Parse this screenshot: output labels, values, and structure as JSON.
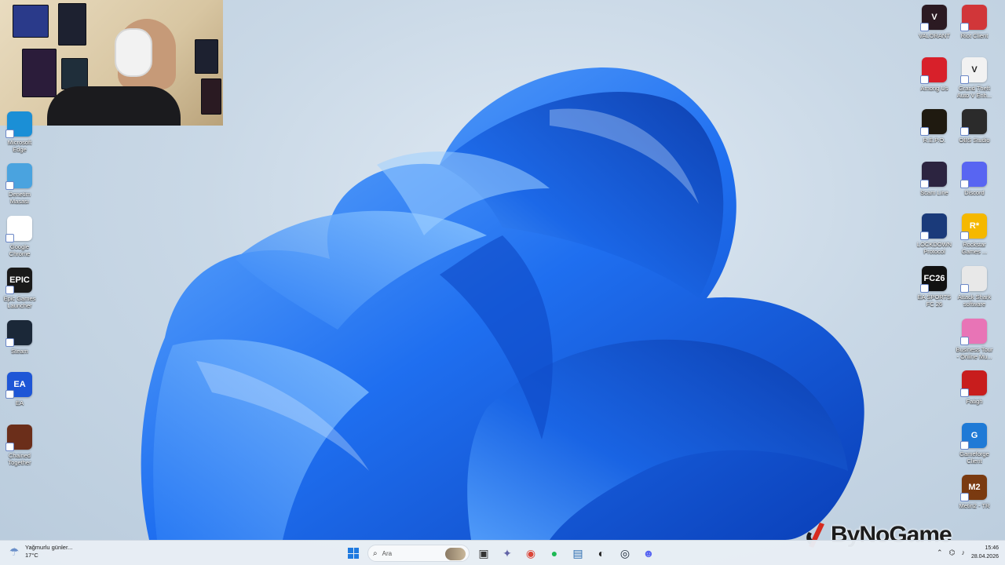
{
  "desktop": {
    "left_icons": [
      {
        "label": "Microsoft\nEdge",
        "color": "#1b8fd6",
        "glyph": "",
        "icon": "edge-icon"
      },
      {
        "label": "Denetim\nMasası",
        "color": "#4aa3df",
        "glyph": "",
        "icon": "control-panel-icon"
      },
      {
        "label": "Google\nChrome",
        "color": "#ffffff",
        "glyph": "",
        "icon": "chrome-icon"
      },
      {
        "label": "Epic Games\nLauncher",
        "color": "#1a1a1a",
        "glyph": "EPIC",
        "icon": "epic-games-icon"
      },
      {
        "label": "Steam",
        "color": "#1b2838",
        "glyph": "",
        "icon": "steam-icon"
      },
      {
        "label": "EA",
        "color": "#1e56d6",
        "glyph": "EA",
        "icon": "ea-icon"
      },
      {
        "label": "Chained\nTogether",
        "color": "#6b2e1a",
        "glyph": "",
        "icon": "chained-together-icon"
      }
    ],
    "right_icons_col1": [
      {
        "label": "VALORANT",
        "color": "#2b1a22",
        "glyph": "V",
        "icon": "valorant-icon"
      },
      {
        "label": "Among Us",
        "color": "#d8202a",
        "glyph": "",
        "icon": "among-us-icon"
      },
      {
        "label": "R.E.P.O.",
        "color": "#1f1a10",
        "glyph": "",
        "icon": "repo-icon"
      },
      {
        "label": "Scam Line",
        "color": "#2c2440",
        "glyph": "",
        "icon": "scam-line-icon"
      },
      {
        "label": "LOCKDOWN\nProtocol",
        "color": "#1a3a7a",
        "glyph": "",
        "icon": "lockdown-protocol-icon"
      },
      {
        "label": "EA SPORTS\nFC 26",
        "color": "#111111",
        "glyph": "FC26",
        "icon": "ea-fc26-icon"
      }
    ],
    "right_icons_col2": [
      {
        "label": "Riot Client",
        "color": "#d13639",
        "glyph": "",
        "icon": "riot-client-icon"
      },
      {
        "label": "Grand Theft\nAuto V Enh...",
        "color": "#f2f2f2",
        "glyph": "V",
        "icon": "gta-v-icon"
      },
      {
        "label": "OBS Studio",
        "color": "#2b2b2b",
        "glyph": "",
        "icon": "obs-studio-icon"
      },
      {
        "label": "Discord",
        "color": "#5865f2",
        "glyph": "",
        "icon": "discord-icon"
      },
      {
        "label": "Rockstar\nGames ...",
        "color": "#f5b800",
        "glyph": "R*",
        "icon": "rockstar-games-icon"
      },
      {
        "label": "Attack Shark\nsoftware",
        "color": "#e8e8e8",
        "glyph": "",
        "icon": "attack-shark-icon"
      },
      {
        "label": "Business Tour\n- Online Mu...",
        "color": "#e874b6",
        "glyph": "",
        "icon": "business-tour-icon"
      },
      {
        "label": "Fatigh",
        "color": "#c81d1d",
        "glyph": "",
        "icon": "fatigh-icon"
      },
      {
        "label": "Gameforge\nClient",
        "color": "#1f7ad6",
        "glyph": "G",
        "icon": "gameforge-icon"
      },
      {
        "label": "Metin2 - TR",
        "color": "#7a3a10",
        "glyph": "M2",
        "icon": "metin2-icon"
      }
    ]
  },
  "watermark": {
    "text": "ByNoGame"
  },
  "taskbar": {
    "weather": {
      "line1": "Yağmurlu günler...",
      "line2": "17°C"
    },
    "search_placeholder": "Ara",
    "apps": [
      {
        "icon": "task-view-icon",
        "glyph": "▣",
        "color": "#333333"
      },
      {
        "icon": "teams-icon",
        "glyph": "✦",
        "color": "#6264a7"
      },
      {
        "icon": "chrome-icon",
        "glyph": "◉",
        "color": "#db4437"
      },
      {
        "icon": "spotify-icon",
        "glyph": "●",
        "color": "#1db954"
      },
      {
        "icon": "remote-desktop-icon",
        "glyph": "▤",
        "color": "#2b6cb0"
      },
      {
        "icon": "obs-icon",
        "glyph": "◐",
        "color": "#222222"
      },
      {
        "icon": "steam-icon",
        "glyph": "◎",
        "color": "#1b2838"
      },
      {
        "icon": "discord-icon",
        "glyph": "☻",
        "color": "#5865f2"
      }
    ],
    "clock": {
      "time": "15:46",
      "date": "28.04.2026"
    }
  }
}
